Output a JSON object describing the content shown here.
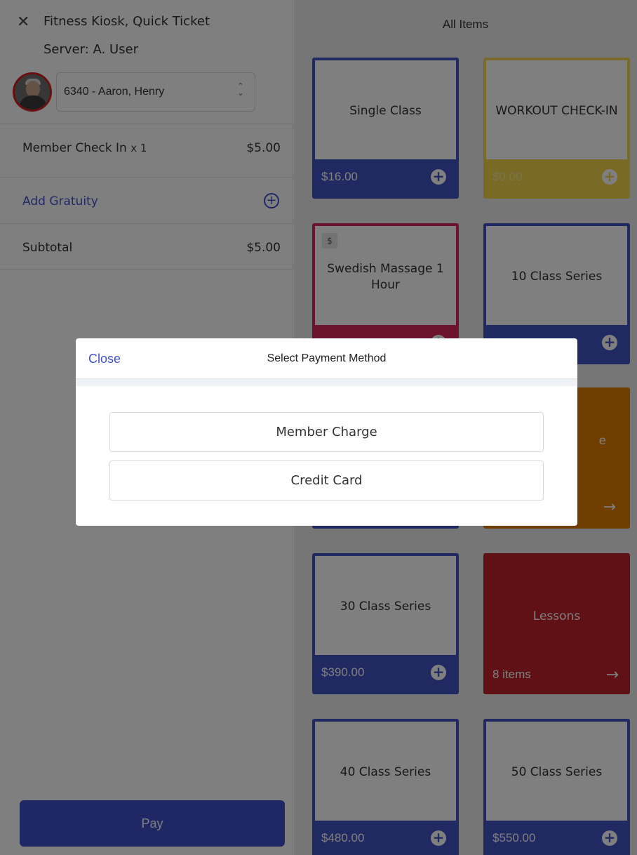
{
  "ticket": {
    "close_glyph": "✕",
    "title": "Fitness Kiosk, Quick Ticket",
    "server": "Server: A. User",
    "member": "6340 - Aaron, Henry",
    "member_chevron": "⌃⌄",
    "line_item": {
      "name": "Member Check In",
      "qty": "x 1",
      "price": "$5.00"
    },
    "gratuity": {
      "label": "Add Gratuity",
      "icon": "plus-circle-icon",
      "glyph": "+"
    },
    "subtotal": {
      "label": "Subtotal",
      "value": "$5.00"
    },
    "pay_label": "Pay"
  },
  "items": {
    "header": "All Items",
    "tiles": [
      {
        "name": "Single Class",
        "price": "$16.00",
        "color": "#4353c4"
      },
      {
        "name": "WORKOUT CHECK-IN",
        "price": "$0.00",
        "color": "#f2d54a"
      },
      {
        "name": "Swedish Massage 1 Hour",
        "price": "",
        "badge": "$",
        "color": "#d9285f"
      },
      {
        "name": "10 Class Series",
        "price": "",
        "color": "#4353c4"
      },
      {
        "name": "e",
        "color": "#e07d00"
      },
      {
        "name": "30 Class Series",
        "price": "$390.00",
        "color": "#4353c4"
      },
      {
        "name": "Lessons",
        "count": "8 items",
        "color": "#c0222a"
      },
      {
        "name": "40 Class Series",
        "price": "$480.00",
        "color": "#4353c4"
      },
      {
        "name": "50 Class Series",
        "price": "$550.00",
        "color": "#4353c4"
      }
    ],
    "add_glyph": "+",
    "arrow_glyph": "→"
  },
  "modal": {
    "close_label": "Close",
    "title": "Select Payment Method",
    "methods": [
      "Member Charge",
      "Credit Card"
    ]
  },
  "colors": {
    "accent": "#3f51c8",
    "tile_blue": "#4353c4",
    "overlay": "rgba(0,0,0,0.5)"
  }
}
